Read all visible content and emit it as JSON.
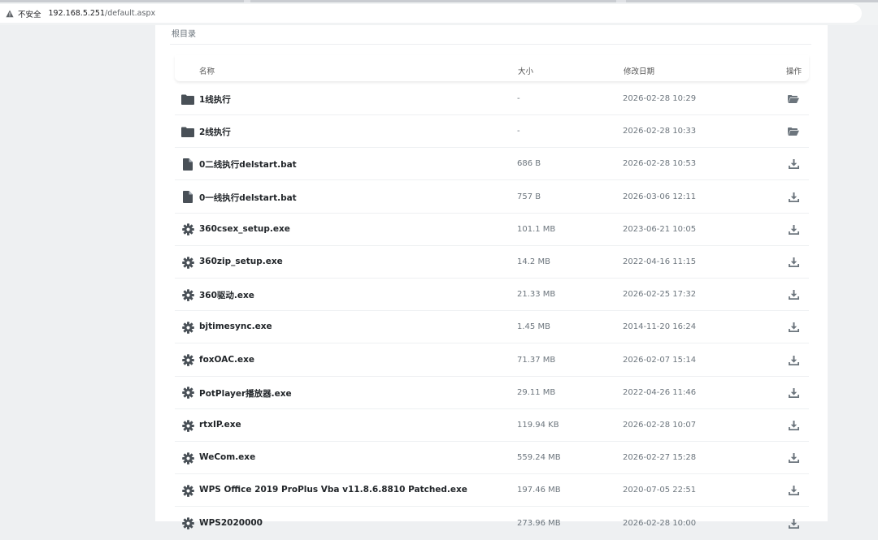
{
  "browser": {
    "security_label": "不安全",
    "url_host": "192.168.5.251",
    "url_path": "/default.aspx"
  },
  "breadcrumb": "根目录",
  "table": {
    "headers": {
      "name": "名称",
      "size": "大小",
      "date": "修改日期",
      "action": "操作"
    },
    "rows": [
      {
        "type": "folder",
        "name": "1线执行",
        "size": "-",
        "date": "2026-02-28 10:29",
        "action_icon": "folder-open-icon"
      },
      {
        "type": "folder",
        "name": "2线执行",
        "size": "-",
        "date": "2026-02-28 10:33",
        "action_icon": "folder-open-icon"
      },
      {
        "type": "file",
        "name": "0二线执行delstart.bat",
        "size": "686 B",
        "date": "2026-02-28 10:53",
        "action_icon": "download-icon"
      },
      {
        "type": "file",
        "name": "0一线执行delstart.bat",
        "size": "757 B",
        "date": "2026-03-06 12:11",
        "action_icon": "download-icon"
      },
      {
        "type": "exe",
        "name": "360csex_setup.exe",
        "size": "101.1 MB",
        "date": "2023-06-21 10:05",
        "action_icon": "download-icon"
      },
      {
        "type": "exe",
        "name": "360zip_setup.exe",
        "size": "14.2 MB",
        "date": "2022-04-16 11:15",
        "action_icon": "download-icon"
      },
      {
        "type": "exe",
        "name": "360驱动.exe",
        "size": "21.33 MB",
        "date": "2026-02-25 17:32",
        "action_icon": "download-icon"
      },
      {
        "type": "exe",
        "name": "bjtimesync.exe",
        "size": "1.45 MB",
        "date": "2014-11-20 16:24",
        "action_icon": "download-icon"
      },
      {
        "type": "exe",
        "name": "foxOAC.exe",
        "size": "71.37 MB",
        "date": "2026-02-07 15:14",
        "action_icon": "download-icon"
      },
      {
        "type": "exe",
        "name": "PotPlayer播放器.exe",
        "size": "29.11 MB",
        "date": "2022-04-26 11:46",
        "action_icon": "download-icon"
      },
      {
        "type": "exe",
        "name": "rtxIP.exe",
        "size": "119.94 KB",
        "date": "2026-02-28 10:07",
        "action_icon": "download-icon"
      },
      {
        "type": "exe",
        "name": "WeCom.exe",
        "size": "559.24 MB",
        "date": "2026-02-27 15:28",
        "action_icon": "download-icon"
      },
      {
        "type": "exe",
        "name": "WPS Office 2019 ProPlus Vba v11.8.6.8810 Patched.exe",
        "size": "197.46 MB",
        "date": "2020-07-05 22:51",
        "action_icon": "download-icon"
      },
      {
        "type": "exe",
        "name": "WPS2020000",
        "size": "273.96 MB",
        "date": "2026-02-28 10:00",
        "action_icon": "download-icon"
      }
    ]
  }
}
